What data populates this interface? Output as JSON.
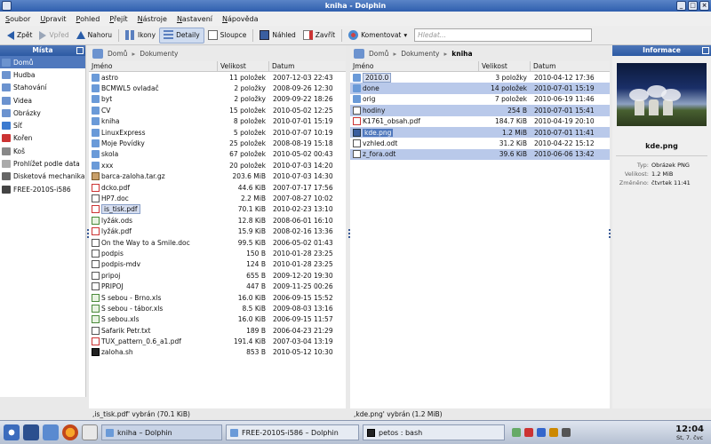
{
  "window": {
    "title": "kniha - Dolphin"
  },
  "menu": [
    "Soubor",
    "Upravit",
    "Pohled",
    "Přejít",
    "Nástroje",
    "Nastavení",
    "Nápověda"
  ],
  "toolbar": {
    "back": "Zpět",
    "forward": "Vpřed",
    "up": "Nahoru",
    "icons": "Ikony",
    "details": "Detaily",
    "columns": "Sloupce",
    "preview": "Náhled",
    "close": "Zavřít",
    "comment": "Komentovat",
    "search_placeholder": "Hledat..."
  },
  "places": {
    "title": "Místa",
    "items": [
      {
        "label": "Domů",
        "color": "#6c93cf"
      },
      {
        "label": "Hudba",
        "color": "#6c93cf"
      },
      {
        "label": "Stahování",
        "color": "#6c93cf"
      },
      {
        "label": "Videa",
        "color": "#6c93cf"
      },
      {
        "label": "Obrázky",
        "color": "#6c93cf"
      },
      {
        "label": "Síť",
        "color": "#3c7bd0"
      },
      {
        "label": "Kořen",
        "color": "#c33"
      },
      {
        "label": "Koš",
        "color": "#888"
      },
      {
        "label": "Prohlížet podle data",
        "color": "#aaa"
      },
      {
        "label": "Disketová mechanika",
        "color": "#666"
      },
      {
        "label": "FREE-2010S-i586",
        "color": "#444"
      }
    ]
  },
  "left": {
    "crumbs": [
      "Domů",
      "Dokumenty"
    ],
    "headers": [
      "Jméno",
      "Velikost",
      "Datum"
    ],
    "rows": [
      {
        "icon": "folder",
        "name": "astro",
        "size": "11 položek",
        "date": "2007-12-03 22:43"
      },
      {
        "icon": "folder",
        "name": "BCMWL5 ovladač",
        "size": "2 položky",
        "date": "2008-09-26 12:30"
      },
      {
        "icon": "folder",
        "name": "byt",
        "size": "2 položky",
        "date": "2009-09-22 18:26"
      },
      {
        "icon": "folder",
        "name": "CV",
        "size": "15 položek",
        "date": "2010-05-02 12:25"
      },
      {
        "icon": "folder",
        "name": "kniha",
        "size": "8 položek",
        "date": "2010-07-01 15:19"
      },
      {
        "icon": "folder",
        "name": "LinuxExpress",
        "size": "5 položek",
        "date": "2010-07-07 10:19"
      },
      {
        "icon": "folder",
        "name": "Moje Povídky",
        "size": "25 položek",
        "date": "2008-08-19 15:18"
      },
      {
        "icon": "folder",
        "name": "skola",
        "size": "67 položek",
        "date": "2010-05-02 00:43"
      },
      {
        "icon": "folder",
        "name": "xxx",
        "size": "20 položek",
        "date": "2010-07-03 14:20"
      },
      {
        "icon": "gz",
        "name": "barca-zaloha.tar.gz",
        "size": "203.6 MiB",
        "date": "2010-07-03 14:30"
      },
      {
        "icon": "pdf",
        "name": "dcko.pdf",
        "size": "44.6 KiB",
        "date": "2007-07-17 17:56"
      },
      {
        "icon": "doc",
        "name": "HP7.doc",
        "size": "2.2 MiB",
        "date": "2007-08-27 10:02"
      },
      {
        "icon": "pdf",
        "name": "is_tisk.pdf",
        "size": "70.1 KiB",
        "date": "2010-02-23 13:10",
        "style": "box"
      },
      {
        "icon": "xls",
        "name": "lyžák.ods",
        "size": "12.8 KiB",
        "date": "2008-06-01 16:10"
      },
      {
        "icon": "pdf",
        "name": "lyžák.pdf",
        "size": "15.9 KiB",
        "date": "2008-02-16 13:36"
      },
      {
        "icon": "doc",
        "name": "On the Way to a Smile.doc",
        "size": "99.5 KiB",
        "date": "2006-05-02 01:43"
      },
      {
        "icon": "doc",
        "name": "podpis",
        "size": "150 B",
        "date": "2010-01-28 23:25"
      },
      {
        "icon": "doc",
        "name": "podpis-mdv",
        "size": "124 B",
        "date": "2010-01-28 23:25"
      },
      {
        "icon": "doc",
        "name": "pripoj",
        "size": "655 B",
        "date": "2009-12-20 19:30"
      },
      {
        "icon": "doc",
        "name": "PRIPOJ",
        "size": "447 B",
        "date": "2009-11-25 00:26"
      },
      {
        "icon": "xls",
        "name": "S sebou - Brno.xls",
        "size": "16.0 KiB",
        "date": "2006-09-15 15:52"
      },
      {
        "icon": "xls",
        "name": "S sebou - tábor.xls",
        "size": "8.5 KiB",
        "date": "2009-08-03 13:16"
      },
      {
        "icon": "xls",
        "name": "S sebou.xls",
        "size": "16.0 KiB",
        "date": "2006-09-15 11:57"
      },
      {
        "icon": "doc",
        "name": "Safarik Petr.txt",
        "size": "189 B",
        "date": "2006-04-23 21:29"
      },
      {
        "icon": "pdf",
        "name": "TUX_pattern_0.6_a1.pdf",
        "size": "191.4 KiB",
        "date": "2007-03-04 13:19"
      },
      {
        "icon": "sh",
        "name": "zaloha.sh",
        "size": "853 B",
        "date": "2010-05-12 10:30"
      }
    ],
    "status": ",is_tisk.pdf' vybrán (70.1 KiB)"
  },
  "right": {
    "crumbs": [
      "Domů",
      "Dokumenty",
      "kniha"
    ],
    "headers": [
      "Jméno",
      "Velikost",
      "Datum"
    ],
    "rows": [
      {
        "icon": "folder",
        "name": "2010.0",
        "size": "3 položky",
        "date": "2010-04-12 17:36",
        "style": "box"
      },
      {
        "icon": "folder",
        "name": "done",
        "size": "14 položek",
        "date": "2010-07-01 15:19",
        "hl": true
      },
      {
        "icon": "folder",
        "name": "orig",
        "size": "7 položek",
        "date": "2010-06-19 11:46"
      },
      {
        "icon": "doc",
        "name": "hodiny",
        "size": "254 B",
        "date": "2010-07-01 15:41",
        "hl": true
      },
      {
        "icon": "pdf",
        "name": "K1761_obsah.pdf",
        "size": "184.7 KiB",
        "date": "2010-04-19 20:10"
      },
      {
        "icon": "img",
        "name": "kde.png",
        "size": "1.2 MiB",
        "date": "2010-07-01 11:41",
        "hl": true,
        "style": "dark"
      },
      {
        "icon": "doc",
        "name": "vzhled.odt",
        "size": "31.2 KiB",
        "date": "2010-04-22 15:12"
      },
      {
        "icon": "doc",
        "name": "z_fora.odt",
        "size": "39.6 KiB",
        "date": "2010-06-06 13:42",
        "hl": true
      }
    ],
    "status": ",kde.png' vybrán (1.2 MiB)"
  },
  "info": {
    "title": "Informace",
    "name": "kde.png",
    "type_k": "Typ:",
    "type_v": "Obrázek PNG",
    "size_k": "Velikost:",
    "size_v": "1.2 MiB",
    "mod_k": "Změněno:",
    "mod_v": "čtvrtek 11:41"
  },
  "taskbar": {
    "tasks": [
      "kniha – Dolphin",
      "FREE-2010S-i586 – Dolphin",
      "petos : bash"
    ],
    "time": "12:04",
    "date": "St, 7. čvc"
  }
}
